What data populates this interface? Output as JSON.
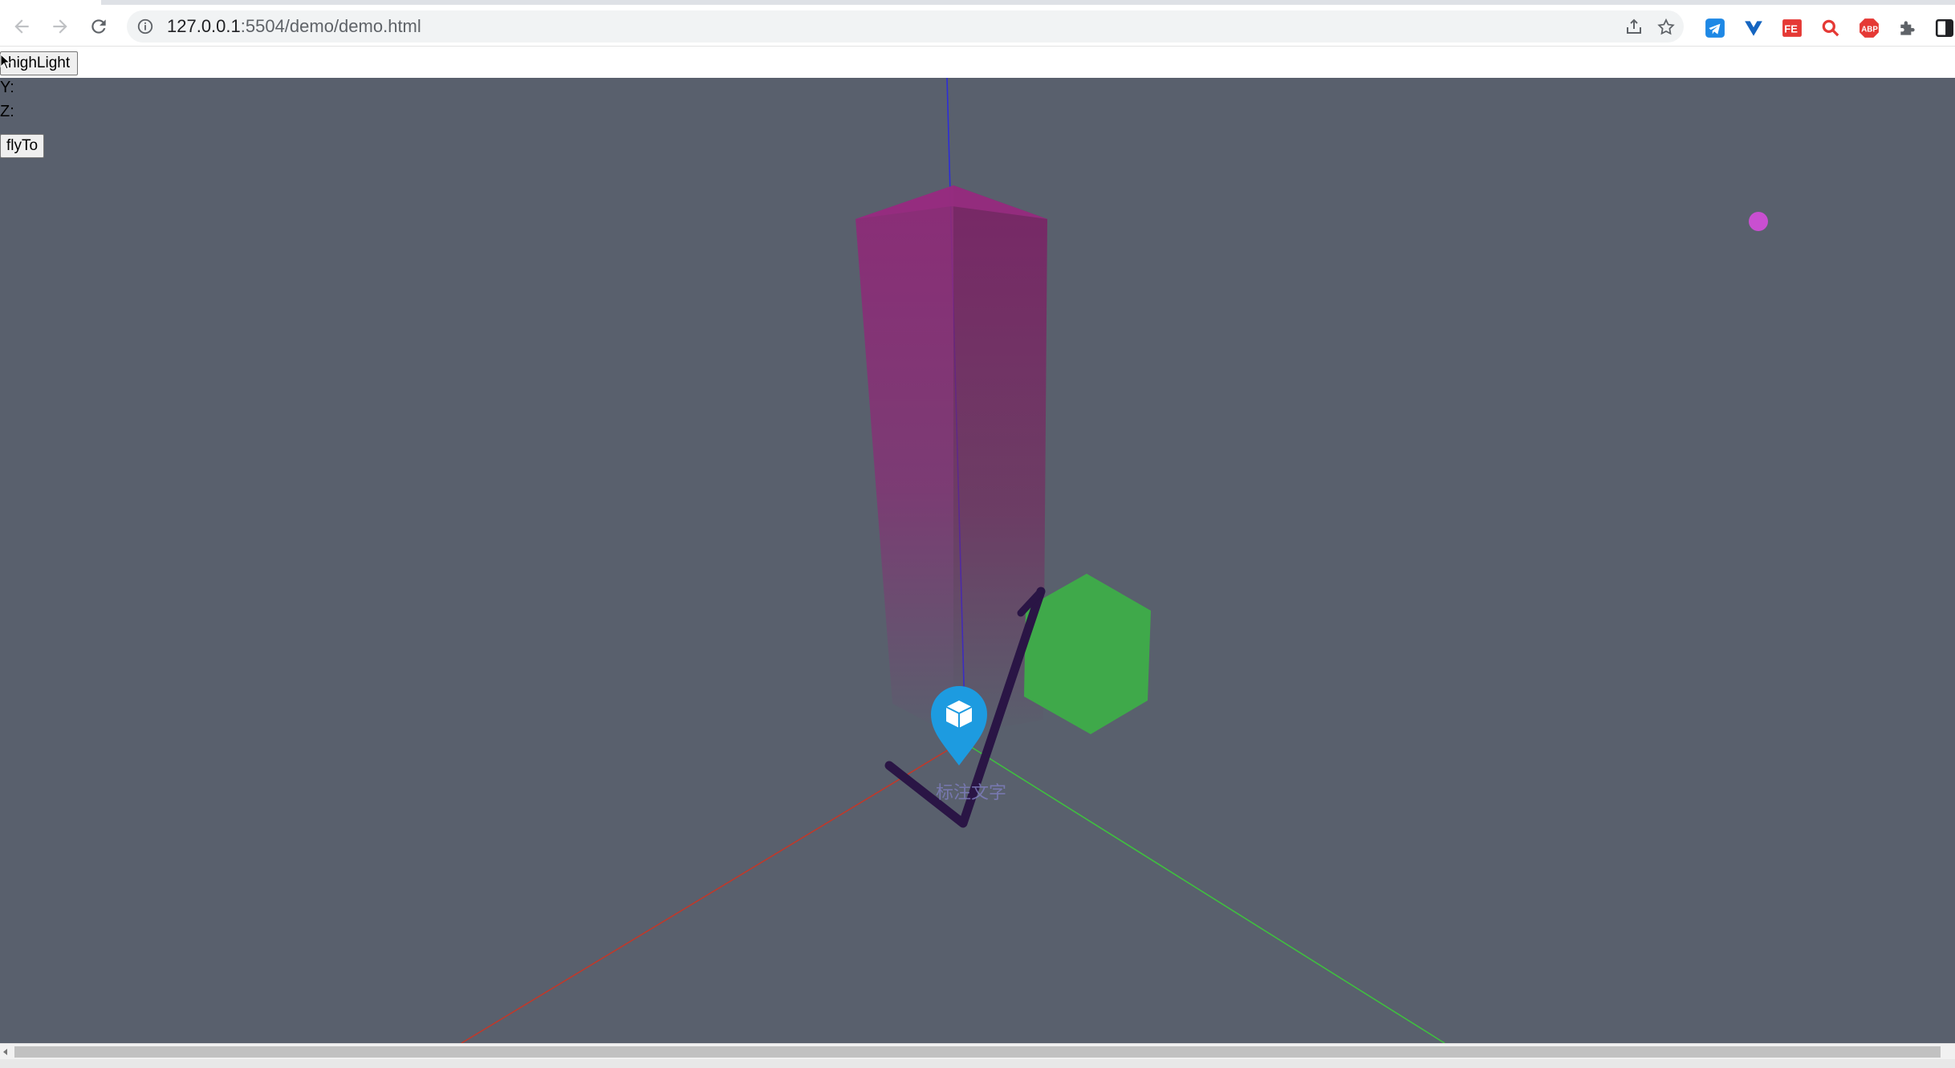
{
  "browser": {
    "url_host": "127.0.0.1",
    "url_path": ":5504/demo/demo.html",
    "extensions": [
      "telegram-icon",
      "vue-devtools-icon",
      "fe-helper-icon",
      "search-extension-icon",
      "adblock-plus-icon",
      "puzzle-extensions-icon",
      "side-panel-icon"
    ]
  },
  "page": {
    "highlight_button": "highLight",
    "y_label": "Y:",
    "z_label": "Z:",
    "flyto_button": "flyTo",
    "marker_label": "标注文字"
  },
  "scene": {
    "background_color": "#59606d",
    "axis_colors": {
      "x": "#c0392b",
      "y": "#3fbf3f",
      "z": "#2d2dd8"
    },
    "box_color": "#9b2a7e",
    "cube_color": "#3fa94a",
    "polyline_color": "#2a1545",
    "marker_color": "#1d9be0",
    "point_color": "#c94fd0"
  }
}
